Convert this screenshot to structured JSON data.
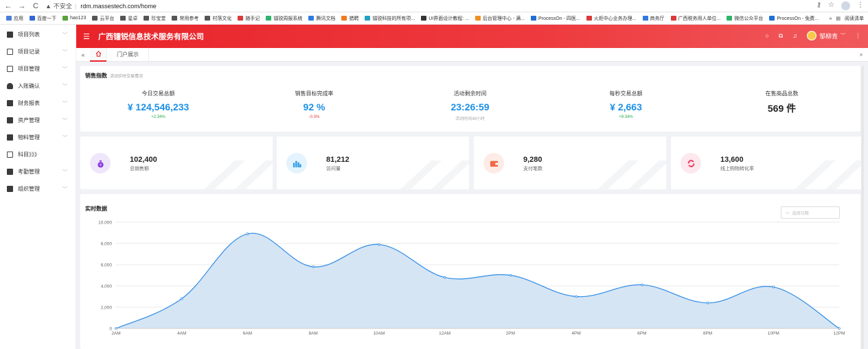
{
  "browser": {
    "not_secure": "不安全",
    "url": "rdm.massestech.com/home",
    "reading_list": "阅读清单",
    "bookmarks": [
      {
        "label": "应用",
        "color": "#4a7fd8"
      },
      {
        "label": "百度一下",
        "color": "#3266d6"
      },
      {
        "label": "hao123",
        "color": "#57a33a"
      },
      {
        "label": "云平台",
        "color": "#555555"
      },
      {
        "label": "星卓",
        "color": "#555555"
      },
      {
        "label": "珍宝堂",
        "color": "#555555"
      },
      {
        "label": "常用参考",
        "color": "#555555"
      },
      {
        "label": "村落文化",
        "color": "#555555"
      },
      {
        "label": "随手记",
        "color": "#d83a3a"
      },
      {
        "label": "镭锐周报系统",
        "color": "#2fb36a"
      },
      {
        "label": "腾讯文档",
        "color": "#2f7be0"
      },
      {
        "label": "猎聘",
        "color": "#f07a22"
      },
      {
        "label": "镭锐科技的所有项...",
        "color": "#25a0c4"
      },
      {
        "label": "UI界面设计教程: ...",
        "color": "#333333"
      },
      {
        "label": "后台管理中心 - 满...",
        "color": "#f09022"
      },
      {
        "label": "ProcessOn - 四医...",
        "color": "#1f6fd6"
      },
      {
        "label": "火炬中心业务办理...",
        "color": "#d83a3a"
      },
      {
        "label": "商务厅",
        "color": "#2f7be0"
      },
      {
        "label": "广西税务用人单位...",
        "color": "#d83a3a"
      },
      {
        "label": "微信公众平台",
        "color": "#2fb36a"
      },
      {
        "label": "ProcessOn - 免费...",
        "color": "#1f6fd6"
      }
    ]
  },
  "sidebar": {
    "items": [
      {
        "label": "项目列表",
        "icon": "folder-icon",
        "chev": "﹀"
      },
      {
        "label": "项目记录",
        "icon": "list-icon",
        "chev": "﹀"
      },
      {
        "label": "项目管理",
        "icon": "window-icon",
        "chev": "﹀"
      },
      {
        "label": "入账确认",
        "icon": "person-icon",
        "chev": "﹀"
      },
      {
        "label": "财务报表",
        "icon": "report-icon",
        "chev": "﹀"
      },
      {
        "label": "资产管理",
        "icon": "briefcase-icon",
        "chev": "﹀"
      },
      {
        "label": "物料管理",
        "icon": "layers-icon",
        "chev": "﹀"
      },
      {
        "label": "科目》》》",
        "icon": "table-icon",
        "chev": ""
      },
      {
        "label": "考勤管理",
        "icon": "calendar-icon",
        "chev": "﹀"
      },
      {
        "label": "组织管理",
        "icon": "group-icon",
        "chev": "﹀"
      }
    ]
  },
  "header": {
    "title": "广西镭锐信息技术服务有限公司",
    "user": "邹柳青",
    "accent": "#e8242a"
  },
  "tabs": {
    "items": [
      "门户展示"
    ]
  },
  "sales": {
    "title": "销售指数",
    "subtitle": "活动实时交易情况",
    "metrics": [
      {
        "label": "今日交易总额",
        "value": "¥ 124,546,233",
        "sub": "+2.34%",
        "sub_class": "up"
      },
      {
        "label": "销售目标完成率",
        "value": "92 %",
        "sub": "-0.3%",
        "sub_class": "down"
      },
      {
        "label": "活动剩余时间",
        "value": "23:26:59",
        "sub": "活动时间48小时",
        "sub_class": "gray"
      },
      {
        "label": "每秒交易总额",
        "value": "¥ 2,663",
        "sub": "+9.34%",
        "sub_class": "up"
      },
      {
        "label": "在售商品总数",
        "value": "569 件",
        "sub": "",
        "sub_class": "gray"
      }
    ]
  },
  "stats": [
    {
      "value": "102,400",
      "label": "总销售额",
      "icon": "money-bag-icon",
      "bg": "#efe6fb",
      "fg": "#8a3ee0"
    },
    {
      "value": "81,212",
      "label": "访问量",
      "icon": "bar-chart-icon",
      "bg": "#e4f3fd",
      "fg": "#2b9ce8"
    },
    {
      "value": "9,280",
      "label": "支付笔数",
      "icon": "wallet-icon",
      "bg": "#fdece6",
      "fg": "#ef6b45"
    },
    {
      "value": "13,600",
      "label": "线上购物转化率",
      "icon": "refresh-icon",
      "bg": "#fde8ee",
      "fg": "#ea3e66"
    }
  ],
  "realtime": {
    "title": "实时数据",
    "date_placeholder": "选择日期"
  },
  "chart_data": {
    "type": "area",
    "categories": [
      "2AM",
      "4AM",
      "6AM",
      "8AM",
      "10AM",
      "12AM",
      "2PM",
      "4PM",
      "6PM",
      "8PM",
      "10PM",
      "12PM"
    ],
    "values": [
      0,
      2800,
      8900,
      5800,
      7900,
      4800,
      5000,
      3000,
      4100,
      2400,
      3900,
      0
    ],
    "ylim": [
      0,
      10000
    ],
    "yticks": [
      "0",
      "2,000",
      "4,000",
      "6,000",
      "8,000",
      "10,000"
    ],
    "color": "#2d8be6",
    "fill": "#d6e5f4",
    "grid": true
  }
}
